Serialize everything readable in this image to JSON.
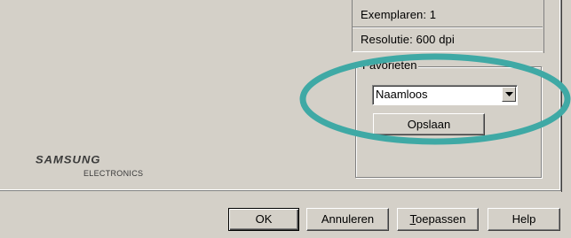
{
  "info": {
    "copies": "Exemplaren: 1",
    "resolution": "Resolutie: 600 dpi"
  },
  "favorites": {
    "group_label": "Favorieten",
    "selected": "Naamloos",
    "save_label": "Opslaan"
  },
  "logo": {
    "brand": "SAMSUNG",
    "sub": "ELECTRONICS"
  },
  "buttons": {
    "ok": "OK",
    "cancel": "Annuleren",
    "apply_first": "T",
    "apply_rest": "oepassen",
    "help": "Help"
  },
  "colors": {
    "dialog_bg": "#d4d0c8",
    "highlight": "#3fa9a5"
  },
  "icons": {
    "dropdown": "chevron-down-icon"
  }
}
